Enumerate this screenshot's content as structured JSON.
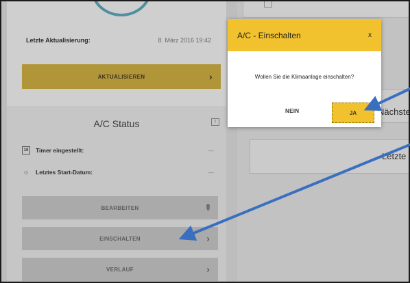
{
  "status_panel": {
    "last_update_label": "Letzte Aktualisierung:",
    "last_update_value": "8. März 2016 19:42",
    "update_button": "AKTUALISIEREN",
    "title": "A/C Status",
    "timer_label": "Timer eingestellt:",
    "timer_value": "—",
    "timer_icon_text": "10",
    "start_date_label": "Letztes Start-Datum:",
    "start_date_value": "—",
    "edit_button": "BEARBEITEN",
    "switch_on_button": "EINSCHALTEN",
    "history_button": "VERLAUF"
  },
  "right_panel": {
    "next_label": "Nächste",
    "last_label": "Letzte"
  },
  "dialog": {
    "title": "A/C - Einschalten",
    "close": "x",
    "message": "Wollen Sie die Klimaanlage einschalten?",
    "no_button": "NEIN",
    "yes_button": "JA"
  },
  "icons": {
    "chevron": "›",
    "pencil": "✎",
    "bulb": "☼",
    "speech": "!"
  },
  "colors": {
    "accent": "#f2c12e",
    "arrow": "#3a6fbf"
  }
}
